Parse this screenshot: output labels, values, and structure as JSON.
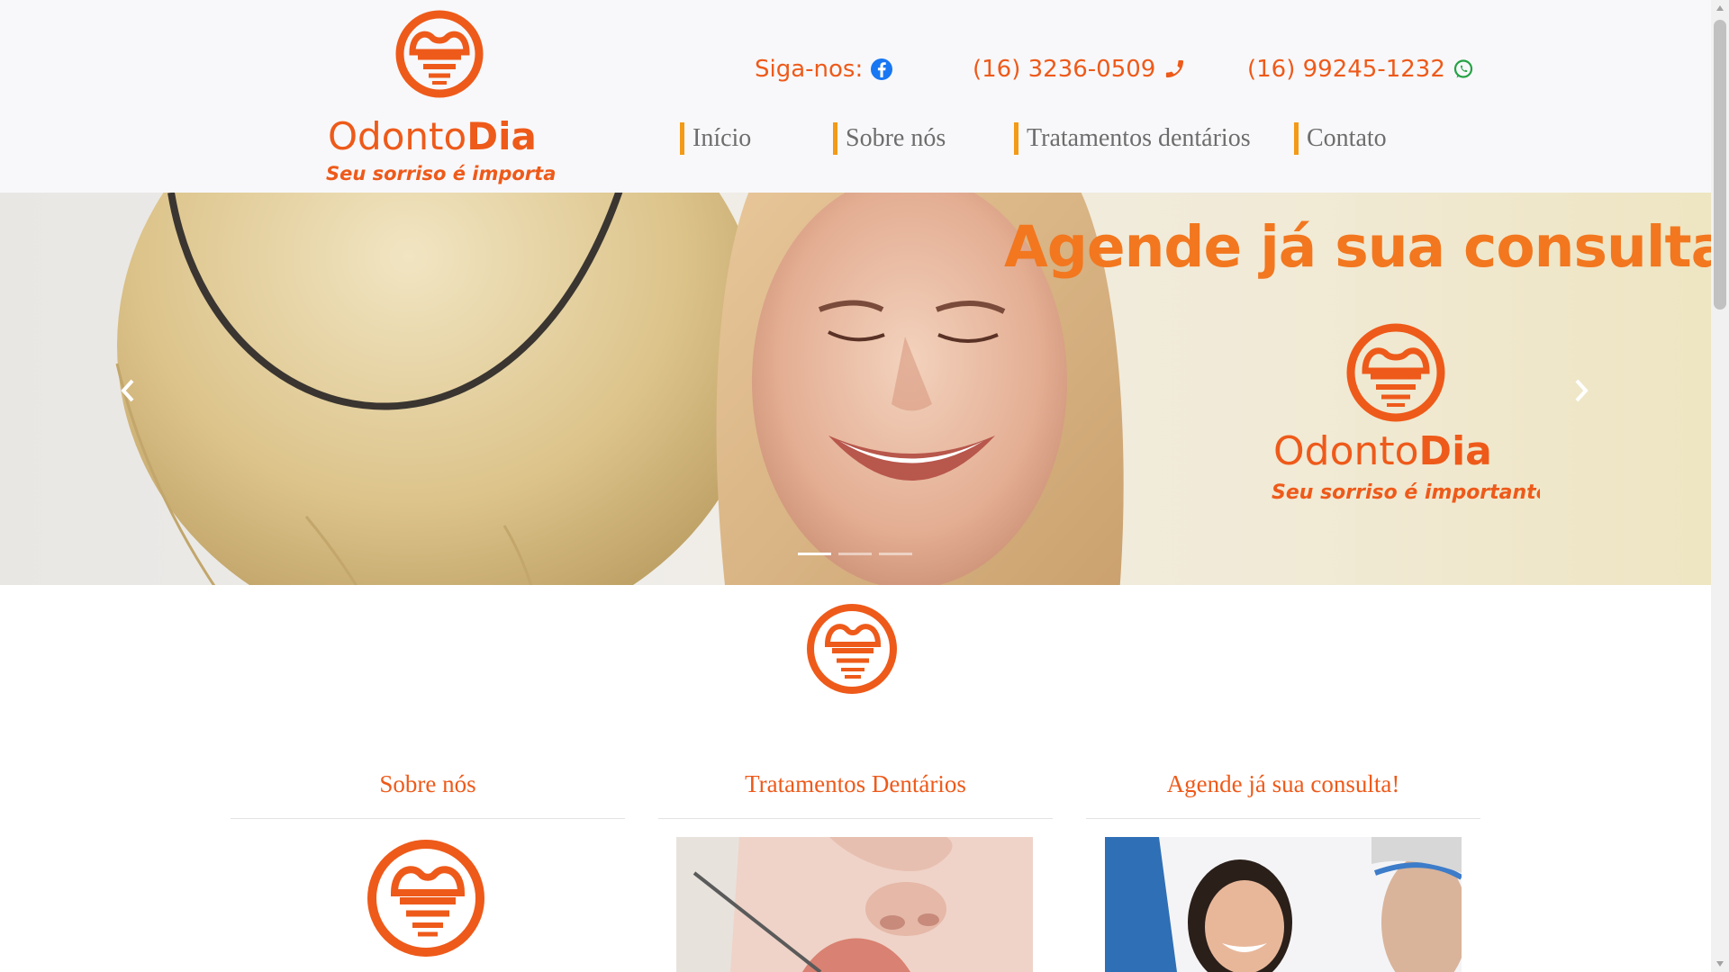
{
  "header": {
    "brand_name_light": "Odonto",
    "brand_name_bold": "Dia",
    "brand_tagline": "Seu sorriso é importante",
    "social_label": "Siga-nos:",
    "social_icon": "facebook-icon",
    "phone_label": "(16) 3236-0509",
    "phone_icon": "phone-icon",
    "whatsapp_label": "(16) 99245-1232",
    "whatsapp_icon": "whatsapp-icon"
  },
  "nav": {
    "items": [
      {
        "label": "Início"
      },
      {
        "label": "Sobre nós"
      },
      {
        "label": "Tratamentos dentários"
      },
      {
        "label": "Contato"
      }
    ]
  },
  "hero": {
    "title": "Agende já sua consulta!",
    "brand_name_light": "Odonto",
    "brand_name_bold": "Dia",
    "brand_tagline": "Seu sorriso é importante",
    "slides_count": 3,
    "active_slide": 1
  },
  "sections": [
    {
      "title": "Sobre nós"
    },
    {
      "title": "Tratamentos Dentários"
    },
    {
      "title": "Agende já sua consulta!"
    }
  ],
  "colors": {
    "brand_orange": "#ee5a1a",
    "nav_accent": "#f39a16",
    "nav_text": "#6d6d6d",
    "facebook_blue": "#1877f2",
    "whatsapp_green": "#25a244"
  }
}
